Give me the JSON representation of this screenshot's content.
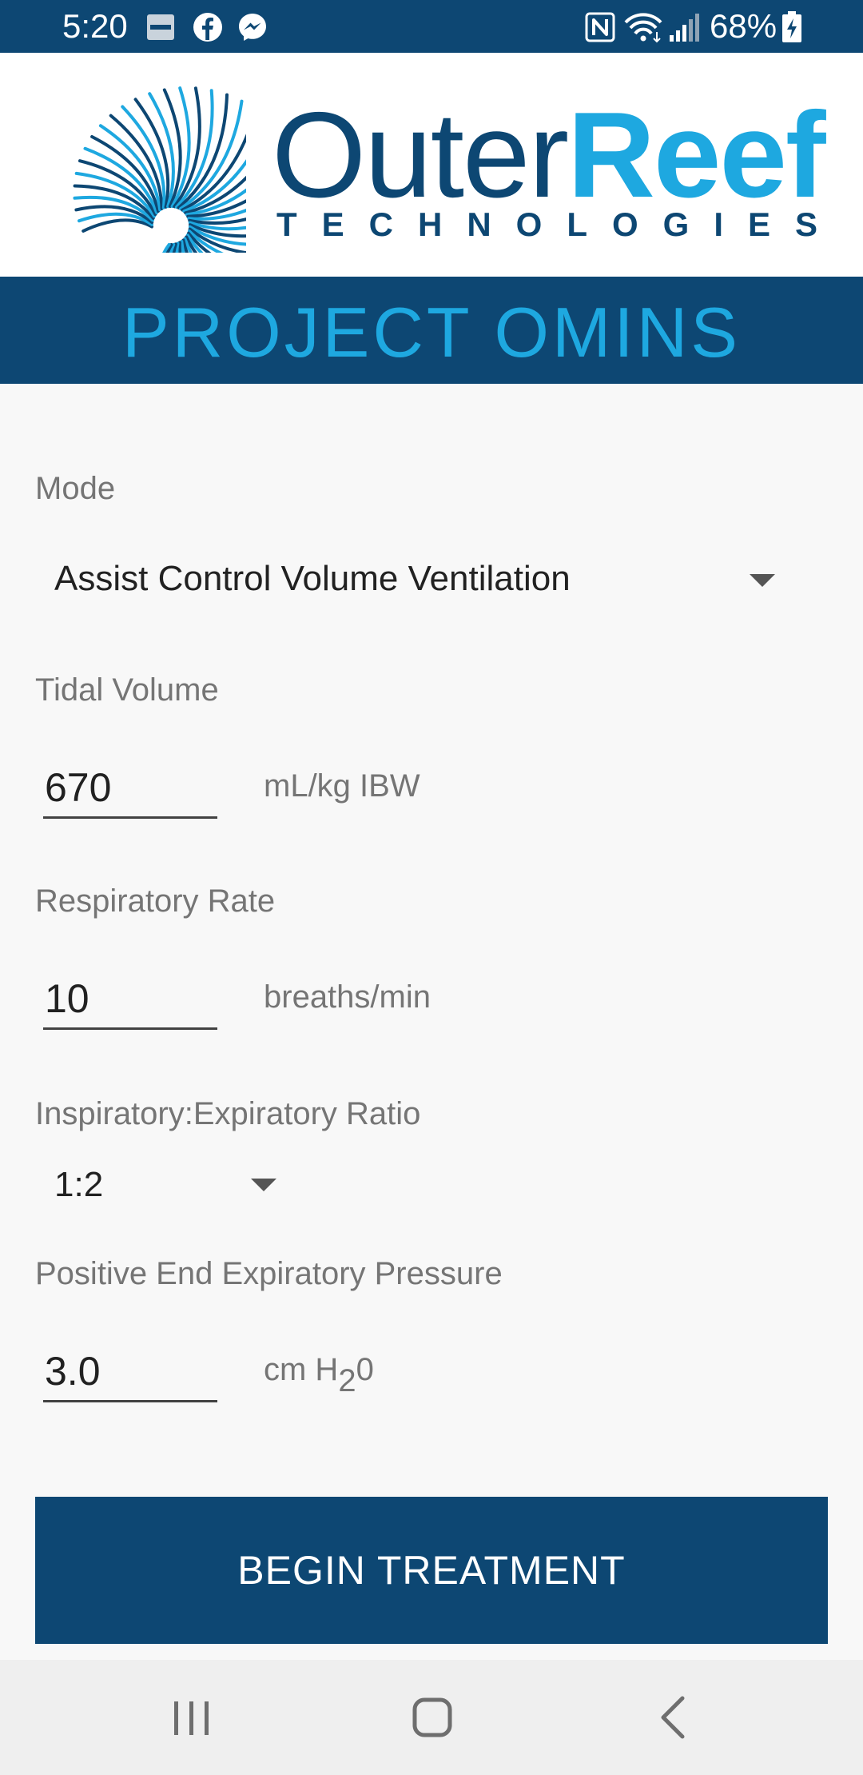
{
  "status_bar": {
    "time": "5:20",
    "battery_percent": "68%",
    "icons": [
      "sonos-icon",
      "facebook-icon",
      "messenger-icon",
      "nfc-icon",
      "wifi-icon",
      "signal-icon",
      "battery-charging-icon"
    ]
  },
  "logo": {
    "word_part1": "Outer",
    "word_part2": "Reef",
    "subtitle": "TECHNOLOGIES",
    "colors": {
      "navy": "#0d4773",
      "cyan": "#1ea8e0"
    }
  },
  "banner": {
    "title": "PROJECT OMINS"
  },
  "form": {
    "mode": {
      "label": "Mode",
      "value": "Assist Control Volume Ventilation"
    },
    "tidal_volume": {
      "label": "Tidal Volume",
      "value": "670",
      "unit": "mL/kg IBW"
    },
    "respiratory_rate": {
      "label": "Respiratory Rate",
      "value": "10",
      "unit": "breaths/min"
    },
    "ie_ratio": {
      "label": "Inspiratory:Expiratory Ratio",
      "value": "1:2"
    },
    "peep": {
      "label": "Positive End Expiratory Pressure",
      "value": "3.0",
      "unit_prefix": "cm H",
      "unit_sub": "2",
      "unit_suffix": "0"
    }
  },
  "action": {
    "button_label": "BEGIN TREATMENT"
  },
  "nav": {
    "buttons": [
      "recents-icon",
      "home-icon",
      "back-icon"
    ]
  }
}
